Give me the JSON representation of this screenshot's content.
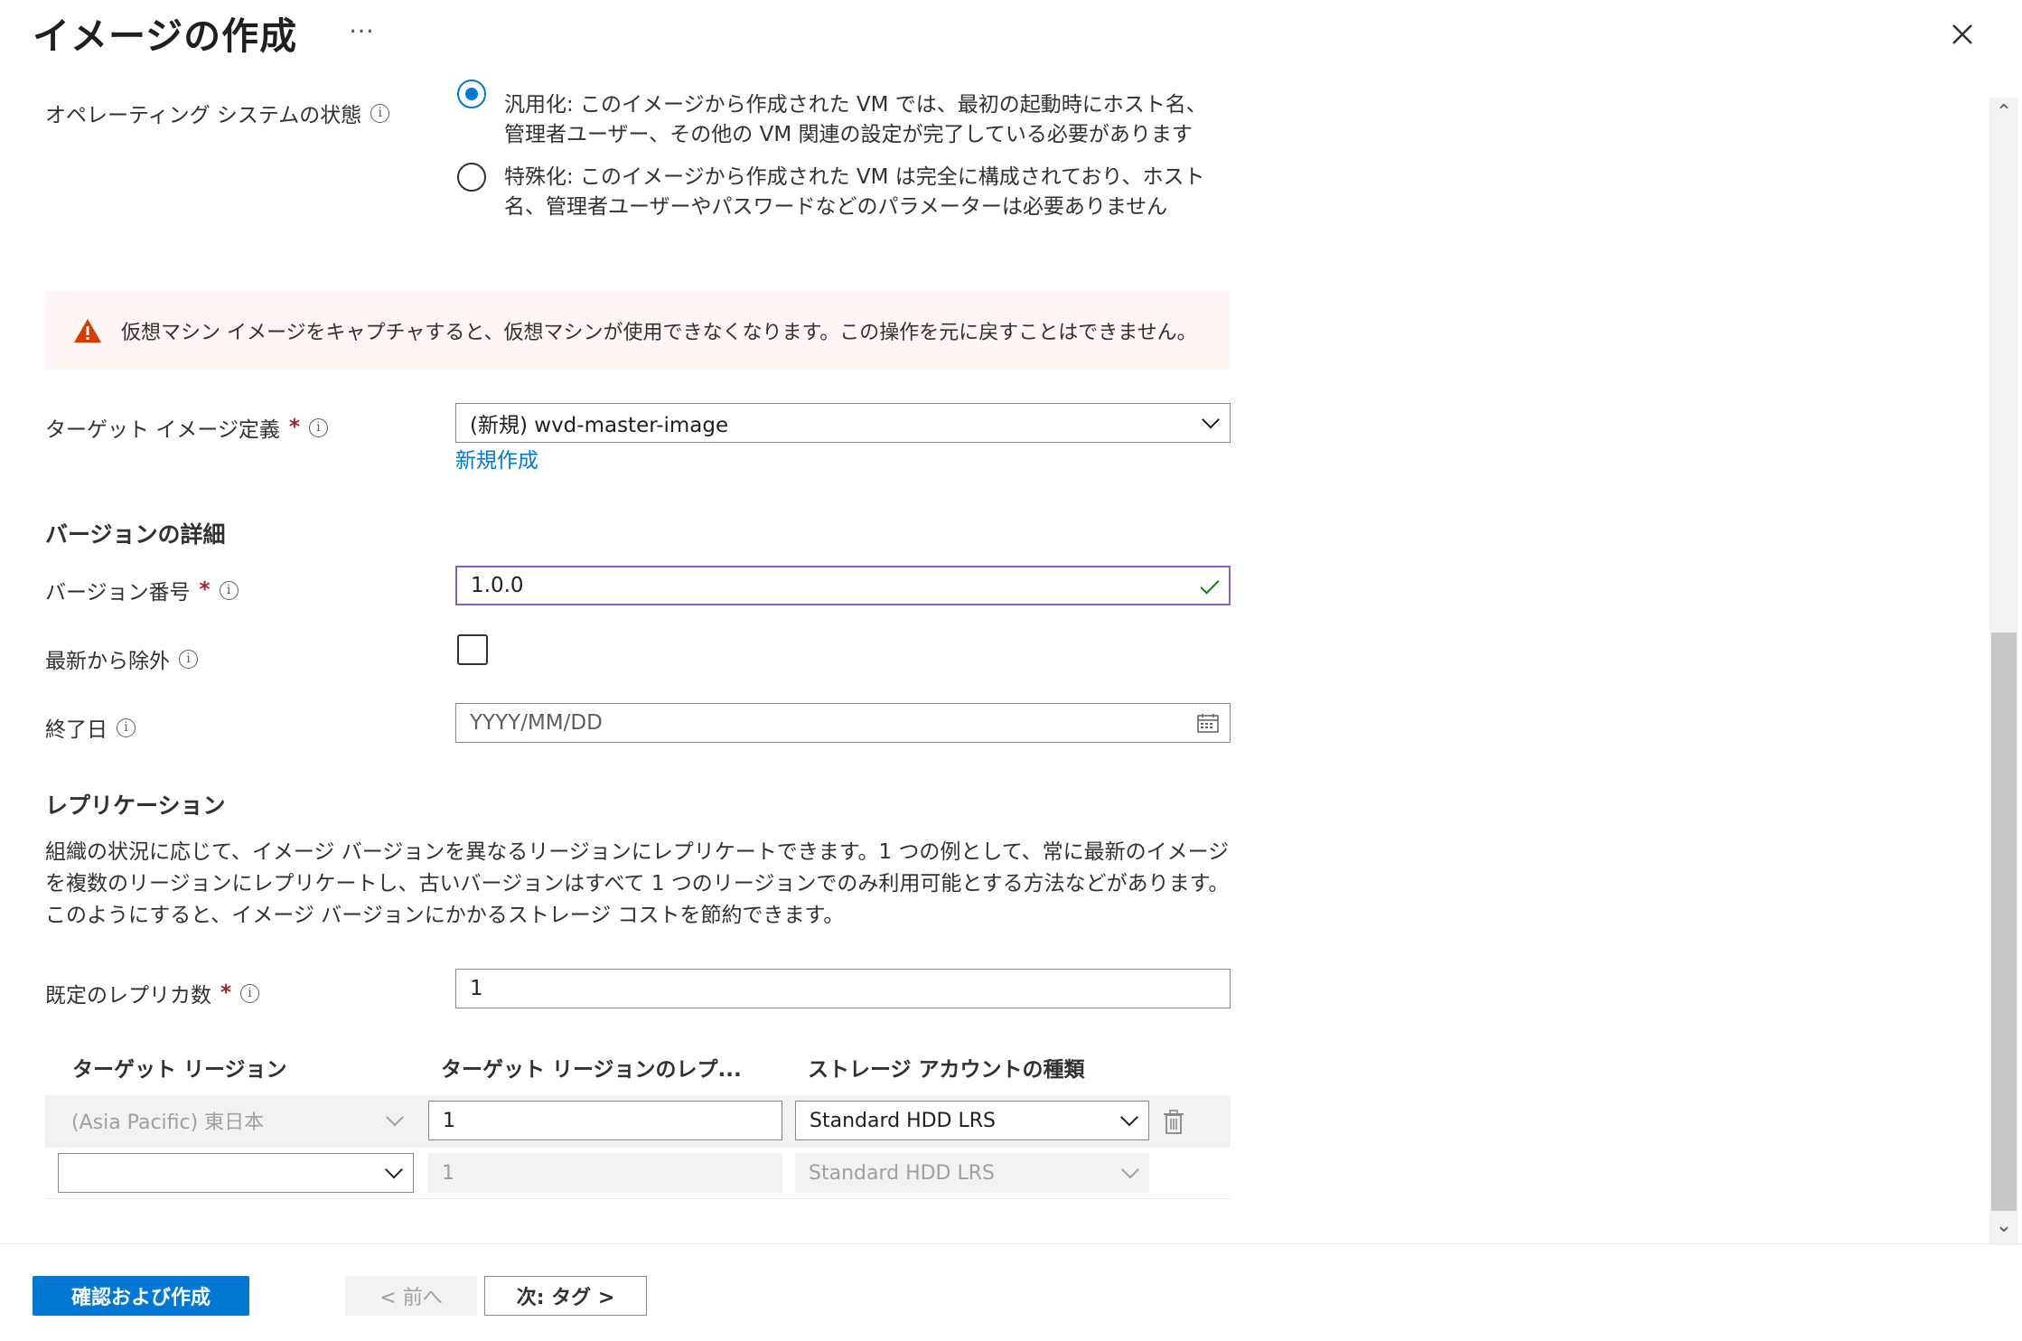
{
  "header": {
    "title": "イメージの作成",
    "more": "…"
  },
  "os_state": {
    "label": "オペレーティング システムの状態",
    "options": [
      {
        "text": "汎用化: このイメージから作成された VM では、最初の起動時にホスト名、管理者ユーザー、その他の VM 関連の設定が完了している必要があります",
        "selected": true
      },
      {
        "text": "特殊化: このイメージから作成された VM は完全に構成されており、ホスト名、管理者ユーザーやパスワードなどのパラメーターは必要ありません",
        "selected": false
      }
    ]
  },
  "warning": {
    "text": "仮想マシン イメージをキャプチャすると、仮想マシンが使用できなくなります。この操作を元に戻すことはできません。"
  },
  "target_image": {
    "label": "ターゲット イメージ定義",
    "required": "*",
    "value": "(新規) wvd-master-image",
    "create_new": "新規作成"
  },
  "version_details": {
    "heading": "バージョンの詳細",
    "version_number": {
      "label": "バージョン番号",
      "required": "*",
      "value": "1.0.0"
    },
    "exclude_latest": {
      "label": "最新から除外",
      "checked": false
    },
    "end_date": {
      "label": "終了日",
      "placeholder": "YYYY/MM/DD"
    }
  },
  "replication": {
    "heading": "レプリケーション",
    "description": "組織の状況に応じて、イメージ バージョンを異なるリージョンにレプリケートできます。1 つの例として、常に最新のイメージを複数のリージョンにレプリケートし、古いバージョンはすべて 1 つのリージョンでのみ利用可能とする方法などがあります。このようにすると、イメージ バージョンにかかるストレージ コストを節約できます。",
    "default_replica": {
      "label": "既定のレプリカ数",
      "required": "*",
      "value": "1"
    },
    "table": {
      "headers": [
        "ターゲット リージョン",
        "ターゲット リージョンのレプ...",
        "ストレージ アカウントの種類"
      ],
      "rows": [
        {
          "region": "(Asia Pacific) 東日本",
          "replicas": "1",
          "storage": "Standard HDD LRS"
        },
        {
          "region": "",
          "replicas": "1",
          "storage": "Standard HDD LRS"
        }
      ]
    }
  },
  "footer": {
    "review_create": "確認および作成",
    "prev": "< 前へ",
    "next": "次: タグ >"
  },
  "colors": {
    "accent": "#0078d4",
    "warning": "#d83b01",
    "success": "#107c10",
    "focus": "#8661c5"
  }
}
